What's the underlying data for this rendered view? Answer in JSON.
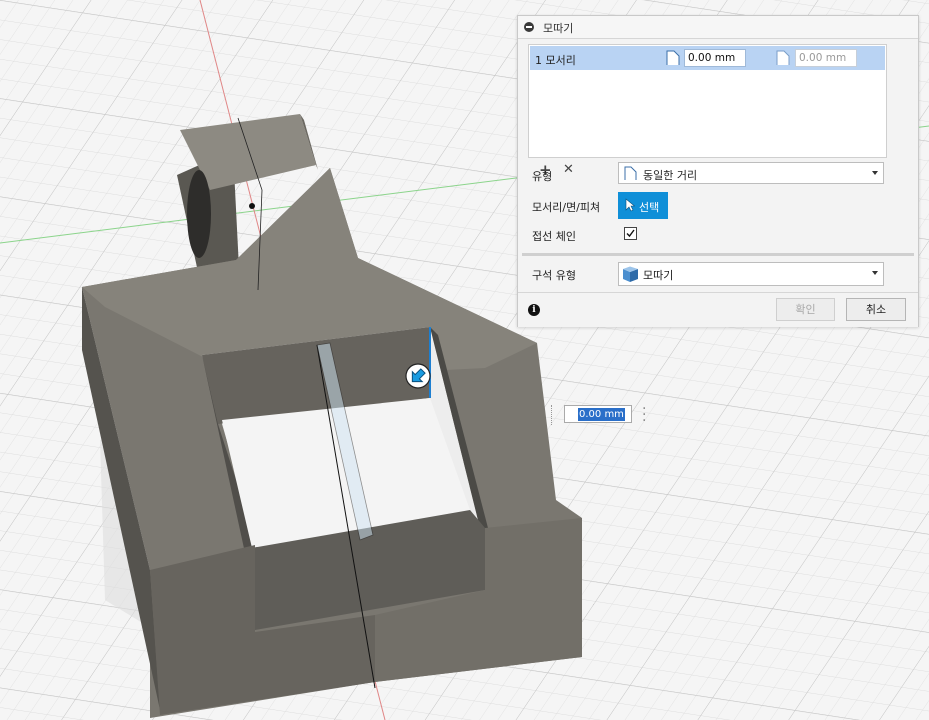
{
  "panel": {
    "title": "모따기",
    "edge_list": {
      "row_label": "1 모서리",
      "distance_1": "0.00 mm",
      "distance_2": "0.00 mm"
    },
    "type": {
      "label": "유형",
      "value": "동일한 거리",
      "icon": "equal-distance-icon"
    },
    "edges": {
      "label": "모서리/면/피쳐",
      "button": "선택",
      "icon": "cursor-arrow-icon"
    },
    "tangent": {
      "label": "접선 체인",
      "checked": true
    },
    "build_type": {
      "label": "구석 유형",
      "value": "모따기",
      "icon": "chamfer-corner-icon"
    },
    "ok_button": "확인",
    "cancel_button": "취소"
  },
  "manipulator": {
    "value": "0.00 mm"
  },
  "colors": {
    "accent": "#0f8fd8",
    "selection": "#b9d3f3",
    "model": "#77746c"
  }
}
